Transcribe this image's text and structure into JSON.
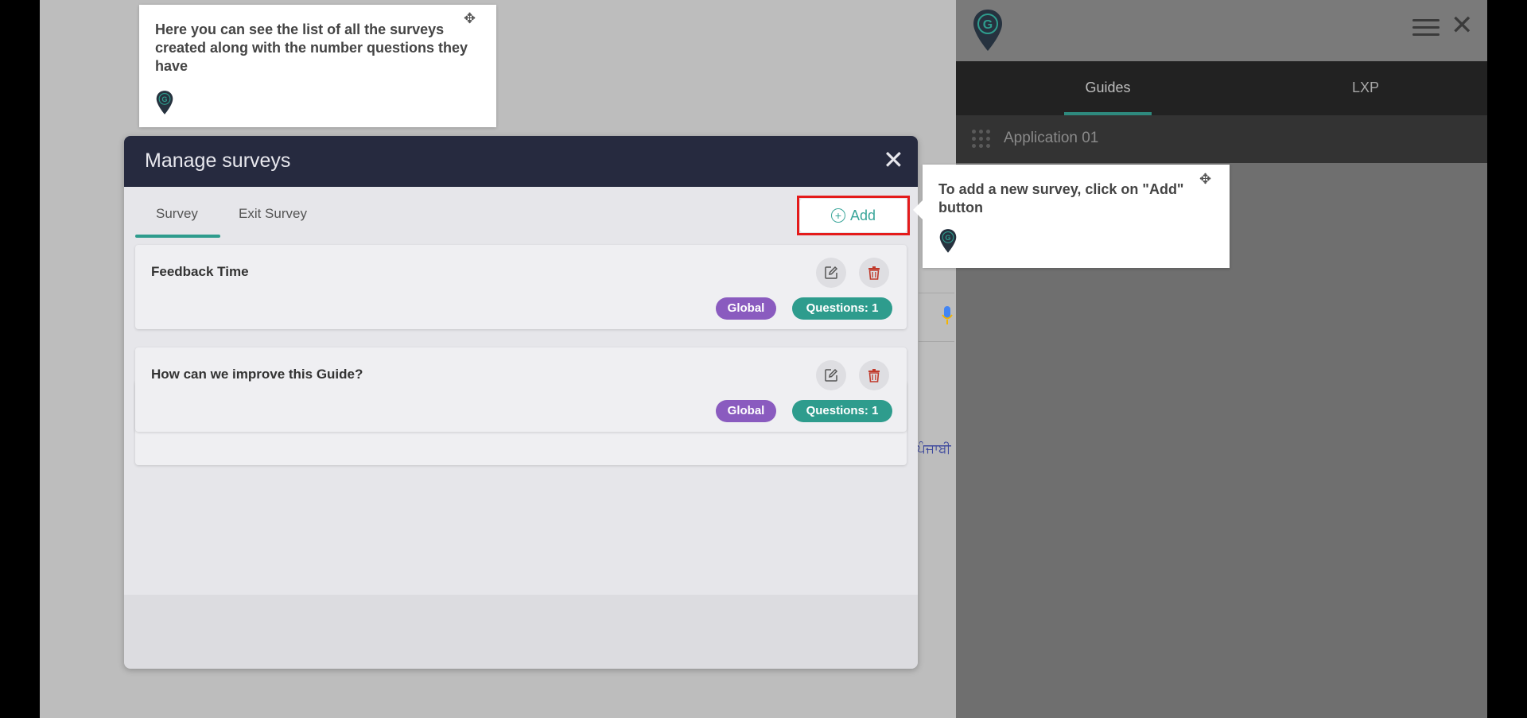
{
  "colors": {
    "modal_header": "#262a3f",
    "accent_teal": "#2e9c8d",
    "global_badge": "#8a5bbf",
    "highlight_red": "#e41b1b",
    "delete_red": "#c0392b"
  },
  "panel": {
    "logo_icon": "g-pin-logo-icon",
    "menu_icon": "hamburger-menu-icon",
    "close_icon": "close-icon",
    "close_glyph": "✕",
    "tabs": [
      {
        "label": "Guides",
        "active": true
      },
      {
        "label": "LXP",
        "active": false
      }
    ],
    "app_icon": "app-grid-dots-icon",
    "app_label": "Application 01"
  },
  "background": {
    "language_link": "ਪੰਜਾਬੀ",
    "mic_icon": "microphone-icon"
  },
  "tooltip_list": {
    "text": "Here you can see the list of all the surveys created along with the number questions they have",
    "move_icon": "move-arrows-icon",
    "move_glyph": "✥",
    "pin_icon": "g-pin-logo-icon"
  },
  "tooltip_add": {
    "text": "To add a new survey, click on \"Add\" button",
    "move_icon": "move-arrows-icon",
    "move_glyph": "✥",
    "pin_icon": "g-pin-logo-icon"
  },
  "modal": {
    "title": "Manage surveys",
    "close_glyph": "✕",
    "tabs": [
      {
        "label": "Survey",
        "active": true
      },
      {
        "label": "Exit Survey",
        "active": false
      }
    ],
    "add_button": {
      "label": "Add",
      "icon": "plus-circle-icon",
      "glyph": "+"
    },
    "surveys": [
      {
        "title": "Feedback Time",
        "scope": "Global",
        "questions": "Questions: 1"
      },
      {
        "title": "How can we improve this Guide?",
        "scope": "Global",
        "questions": "Questions: 1"
      }
    ]
  }
}
